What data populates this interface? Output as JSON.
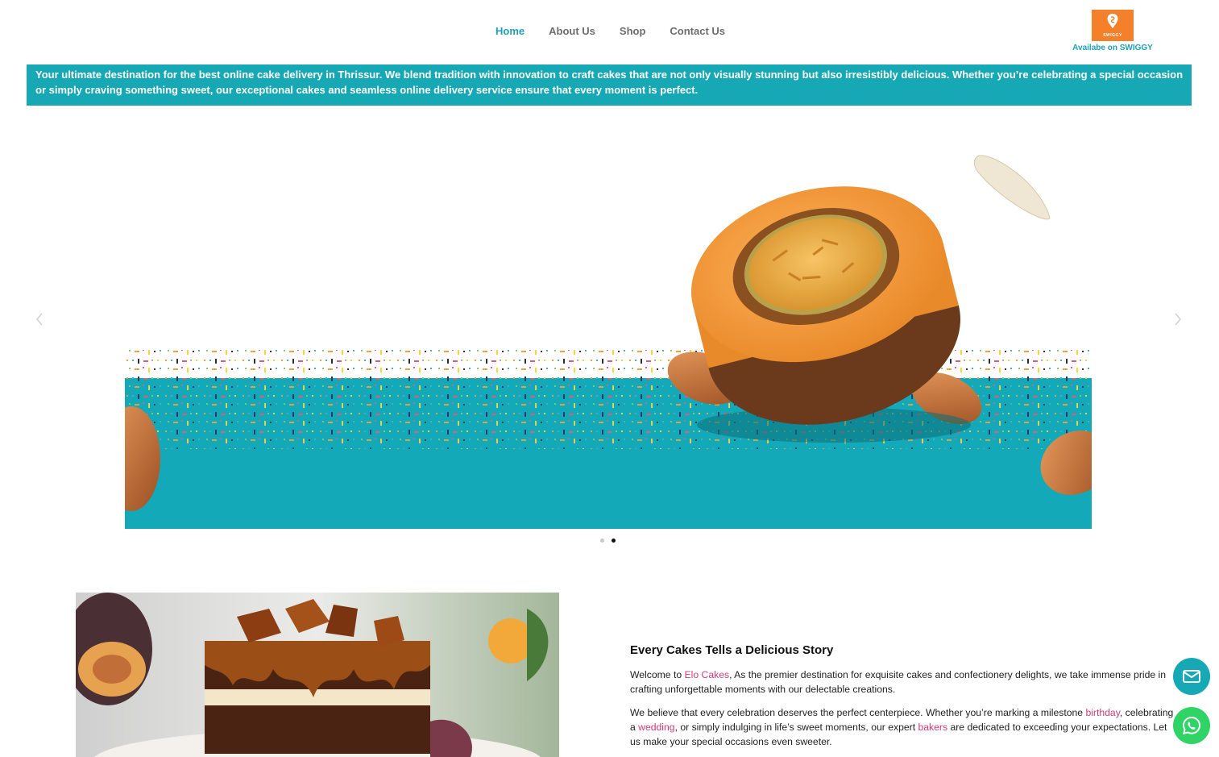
{
  "nav": {
    "items": [
      {
        "label": "Home",
        "active": true
      },
      {
        "label": "About Us",
        "active": false
      },
      {
        "label": "Shop",
        "active": false
      },
      {
        "label": "Contact Us",
        "active": false
      }
    ]
  },
  "swiggy": {
    "logo_text": "SWIGGY",
    "caption": "Availabe on SWIGGY",
    "brand_color": "#f4812a"
  },
  "banner": {
    "text": "Your ultimate destination for the best online cake delivery in Thrissur. We blend tradition with innovation to craft cakes that are not only visually stunning but also irresistibly delicious. Whether you’re celebrating a special occasion or simply craving something sweet, our exceptional cakes and seamless online delivery service ensure that every moment is perfect.",
    "color": "#17a8b5"
  },
  "slider": {
    "prev_icon": "chevron-left-icon",
    "next_icon": "chevron-right-icon",
    "slide_count": 2,
    "active_slide": 2
  },
  "about": {
    "title": "Every Cakes Tells a Delicious Story",
    "p1_before": "Welcome to ",
    "p1_link": "Elo Cakes",
    "p1_after": ", As the premier destination for exquisite cakes and confectionery delights, we take immense pride in crafting unforgettable moments with our delectable creations.",
    "p2_a": "We believe that every celebration deserves the perfect centerpiece. Whether you’re marking a milestone ",
    "p2_link1": "birthday",
    "p2_b": ", celebrating a ",
    "p2_link2": "wedding",
    "p2_c": ", or simply indulging in life’s sweet moments, our expert ",
    "p2_link3": "bakers",
    "p2_d": " are dedicated to exceeding your expectations. Let us make your special occasions even sweeter.",
    "link_color": "#d23b7a"
  },
  "fabs": {
    "mail_icon": "mail-icon",
    "whatsapp_icon": "whatsapp-icon"
  }
}
